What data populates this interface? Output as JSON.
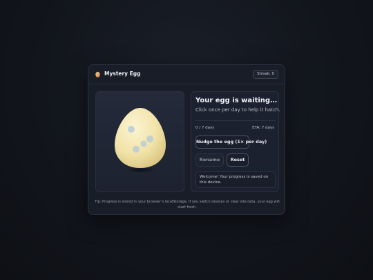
{
  "app": {
    "title": "Mystery Egg",
    "streak": "Streak: 0"
  },
  "status": {
    "heading": "Your egg is waiting…",
    "subtitle": "Click once per day to help it hatch.",
    "progress_label": "0 / 7 days",
    "progress_value": 0,
    "progress_total": 7,
    "eta": "ETA: 7 days"
  },
  "buttons": {
    "nudge": "Nudge the egg (1× per day)",
    "rename": "Rename",
    "reset": "Reset"
  },
  "message": "Welcome! Your progress is saved on this device.",
  "tip": "Tip: Progress is stored in your browser’s localStorage. If you switch devices or clear site data, your egg will start fresh.",
  "icons": {
    "logo": "egg-icon"
  },
  "colors": {
    "egg_shell": "#f4e8b4",
    "egg_spots": "#b9cbd6"
  }
}
